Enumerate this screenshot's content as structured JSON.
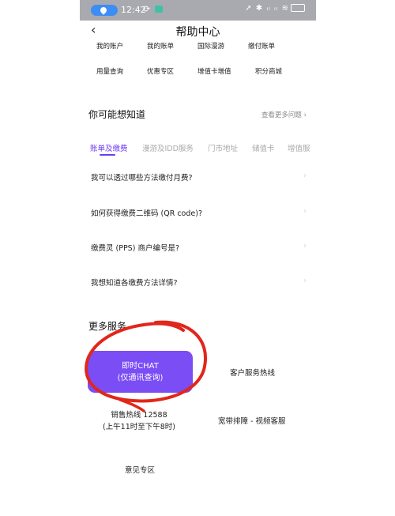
{
  "status_bar": {
    "time": "12:42",
    "right_icons": "➚ ✱ ᵢₗ ᵢₗ ≋"
  },
  "header": {
    "title": "帮助中心",
    "back_glyph": "‹"
  },
  "quick_links": [
    [
      "我的账户",
      "我的账单",
      "国际漫游",
      "缴付账单"
    ],
    [
      "用量查询",
      "优惠专区",
      "增值卡增值",
      "积分商城"
    ]
  ],
  "faq_section": {
    "title": "你可能想知道",
    "more": "查看更多问题 ›",
    "tabs": [
      "账单及缴费",
      "漫游及IDD服务",
      "门市地址",
      "储值卡",
      "增值服"
    ],
    "items": [
      "我可以透过哪些方法缴付月费?",
      "如何获得缴费二维码 (QR code)?",
      "缴费灵 (PPS) 商户编号是?",
      "我想知道各缴费方法详情?"
    ]
  },
  "more_services": {
    "title": "更多服务",
    "chat": {
      "line1": "即时CHAT",
      "line2": "(仅通讯查询)"
    },
    "hotline": "客户服务热线",
    "sales": {
      "line1": "销售热线 12588",
      "line2": "(上午11时至下午8时)"
    },
    "broadband": "宽带排障 - 视频客服",
    "feedback": "意见专区"
  },
  "colors": {
    "accent": "#6e3bf2",
    "chat_button": "#7a4df5",
    "annotation": "#e1261c",
    "status_bar": "#a9aab0"
  }
}
